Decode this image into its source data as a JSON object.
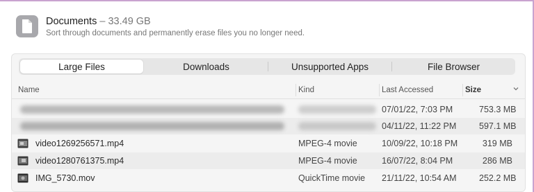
{
  "header": {
    "title": "Documents",
    "title_suffix": "– 33.49 GB",
    "subtitle": "Sort through documents and permanently erase files you no longer need.",
    "icon": "document-icon"
  },
  "tabs": [
    {
      "label": "Large Files",
      "active": true
    },
    {
      "label": "Downloads",
      "active": false
    },
    {
      "label": "Unsupported Apps",
      "active": false
    },
    {
      "label": "File Browser",
      "active": false
    }
  ],
  "table": {
    "columns": {
      "name": "Name",
      "kind": "Kind",
      "last_accessed": "Last Accessed",
      "size": "Size"
    },
    "sort_icon": "chevron-down-icon",
    "rows": [
      {
        "name": "",
        "kind": "",
        "last_accessed": "07/01/22, 7:03 PM",
        "size": "753.3 MB",
        "redacted": true
      },
      {
        "name": "",
        "kind": "",
        "last_accessed": "04/11/22, 11:22 PM",
        "size": "597.1 MB",
        "redacted": true
      },
      {
        "name": "video1269256571.mp4",
        "kind": "MPEG-4 movie",
        "last_accessed": "10/09/22, 10:18 PM",
        "size": "319 MB",
        "icon": "video-file-icon"
      },
      {
        "name": "video1280761375.mp4",
        "kind": "MPEG-4 movie",
        "last_accessed": "16/07/22, 8:04 PM",
        "size": "286 MB",
        "icon": "video-file-icon"
      },
      {
        "name": "IMG_5730.mov",
        "kind": "QuickTime movie",
        "last_accessed": "21/11/22, 10:54 AM",
        "size": "252.2 MB",
        "icon": "movie-file-icon"
      }
    ]
  },
  "colors": {
    "accent_border": "#c9a3cf",
    "icon_gray": "#a8a8ac"
  }
}
